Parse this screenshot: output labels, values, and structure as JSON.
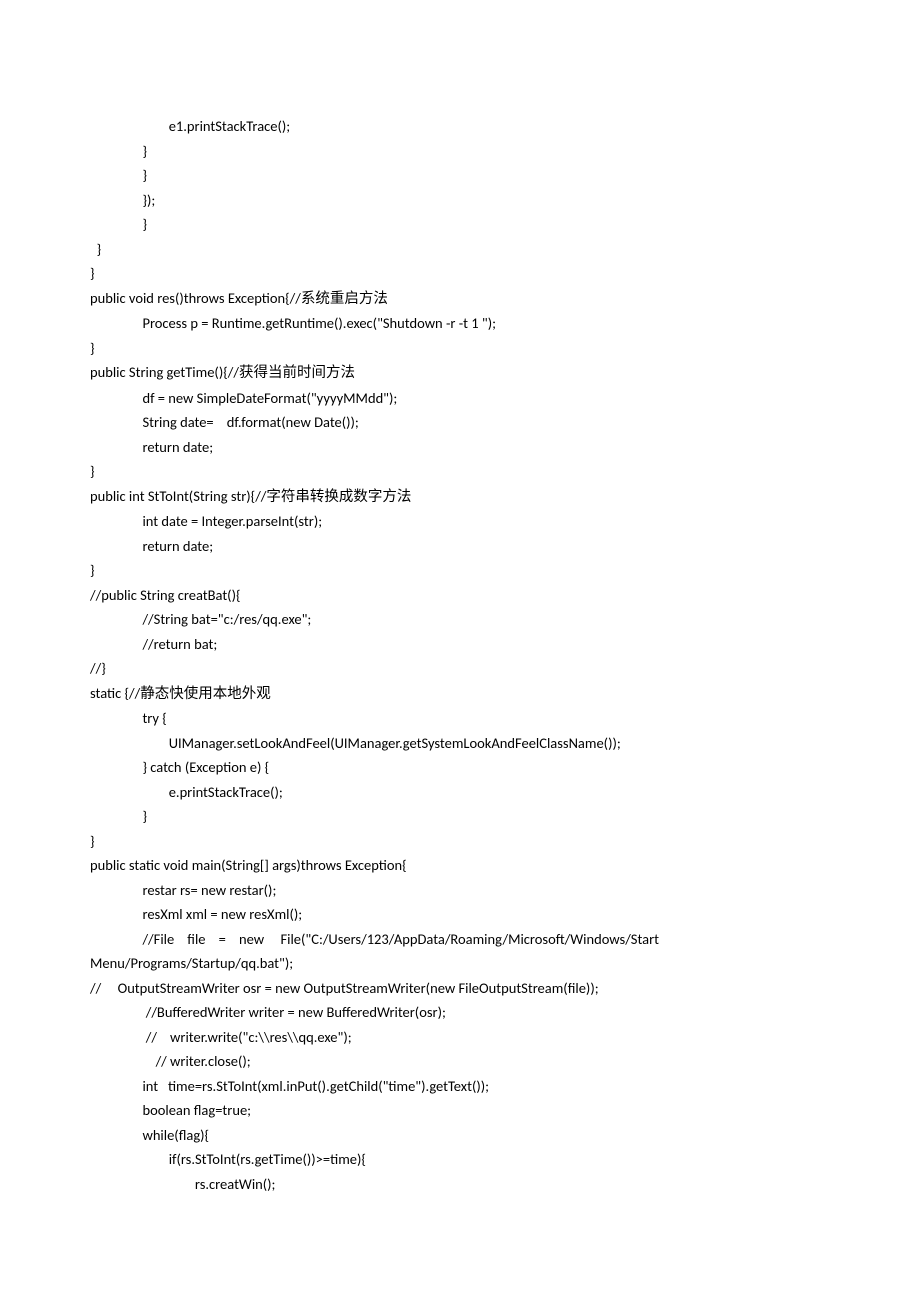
{
  "code": {
    "lines": [
      "\t\t\te1.printStackTrace();",
      "\t\t}",
      "\t\t}",
      "\t\t});",
      "\t\t}",
      "  }",
      "}",
      "public void res()throws Exception{//系统重启方法",
      "\t\tProcess p = Runtime.getRuntime().exec(\"Shutdown -r -t 1 \");",
      "}",
      "public String getTime(){//获得当前时间方法",
      "\t\tdf = new SimpleDateFormat(\"yyyyMMdd\");",
      "\t\tString date=    df.format(new Date());",
      "\t\treturn date;",
      "}",
      "public int StToInt(String str){//字符串转换成数字方法",
      "\t\tint date = Integer.parseInt(str);",
      "\t\treturn date;",
      "}",
      "//public String creatBat(){",
      "\t\t//String bat=\"c:/res/qq.exe\";",
      "\t\t//return bat;",
      "//}",
      "static {//静态快使用本地外观",
      "\t\ttry {",
      "\t\t\tUIManager.setLookAndFeel(UIManager.getSystemLookAndFeelClassName());",
      "\t\t} catch (Exception e) {",
      "\t\t\te.printStackTrace();",
      "\t\t}",
      "}",
      "public static void main(String[] args)throws Exception{",
      "\t\trestar rs= new restar();",
      "\t\tresXml xml = new resXml();",
      "\t\t//File    file    =    new     File(\"C:/Users/123/AppData/Roaming/Microsoft/Windows/Start Menu/Programs/Startup/qq.bat\");",
      "//     OutputStreamWriter osr = new OutputStreamWriter(new FileOutputStream(file));",
      "\t\t //BufferedWriter writer = new BufferedWriter(osr);",
      "\t\t //    writer.write(\"c:\\\\res\\\\qq.exe\");",
      "\t\t    // writer.close();",
      "\t\tint   time=rs.StToInt(xml.inPut().getChild(\"time\").getText());",
      "\t\tboolean flag=true;",
      "\t\twhile(flag){",
      "\t\t\tif(rs.StToInt(rs.getTime())>=time){",
      "\t\t\t\trs.creatWin();"
    ]
  }
}
